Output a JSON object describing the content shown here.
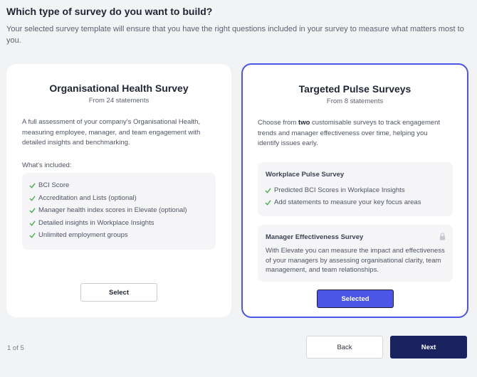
{
  "page": {
    "title": "Which type of survey do you want to build?",
    "subtitle": "Your selected survey template will ensure that you have the right questions included in your survey to measure what matters most to you."
  },
  "card_a": {
    "title": "Organisational Health Survey",
    "statements": "From 24 statements",
    "description": "A full assessment of your company's Organisational Health, measuring employee, manager, and team engagement with detailed insights and benchmarking.",
    "included_label": "What's included:",
    "features": [
      "BCI Score",
      "Accreditation and Lists (optional)",
      "Manager health index scores in Elevate (optional)",
      "Detailed insights in Workplace Insights",
      "Unlimited employment groups"
    ],
    "button_label": "Select"
  },
  "card_b": {
    "title": "Targeted Pulse Surveys",
    "statements": "From 8 statements",
    "description_pre": "Choose from ",
    "description_bold": "two",
    "description_post": " customisable surveys to track engagement trends and manager effectiveness over time, helping you identify issues early.",
    "pulse": {
      "title": "Workplace Pulse Survey",
      "features": [
        "Predicted BCI Scores in Workplace Insights",
        "Add statements to measure your key focus areas"
      ]
    },
    "manager": {
      "title": "Manager Effectiveness Survey",
      "text": "With Elevate you can measure the impact and effectiveness of your managers by assessing organisational clarity, team management, and team relationships.",
      "icon": "lock-icon"
    },
    "button_label": "Selected"
  },
  "footer": {
    "page_indicator": "1 of 5",
    "back_label": "Back",
    "next_label": "Next"
  },
  "colors": {
    "accent": "#4b56e6",
    "next_button": "#1b2260",
    "check": "#4caf50"
  }
}
